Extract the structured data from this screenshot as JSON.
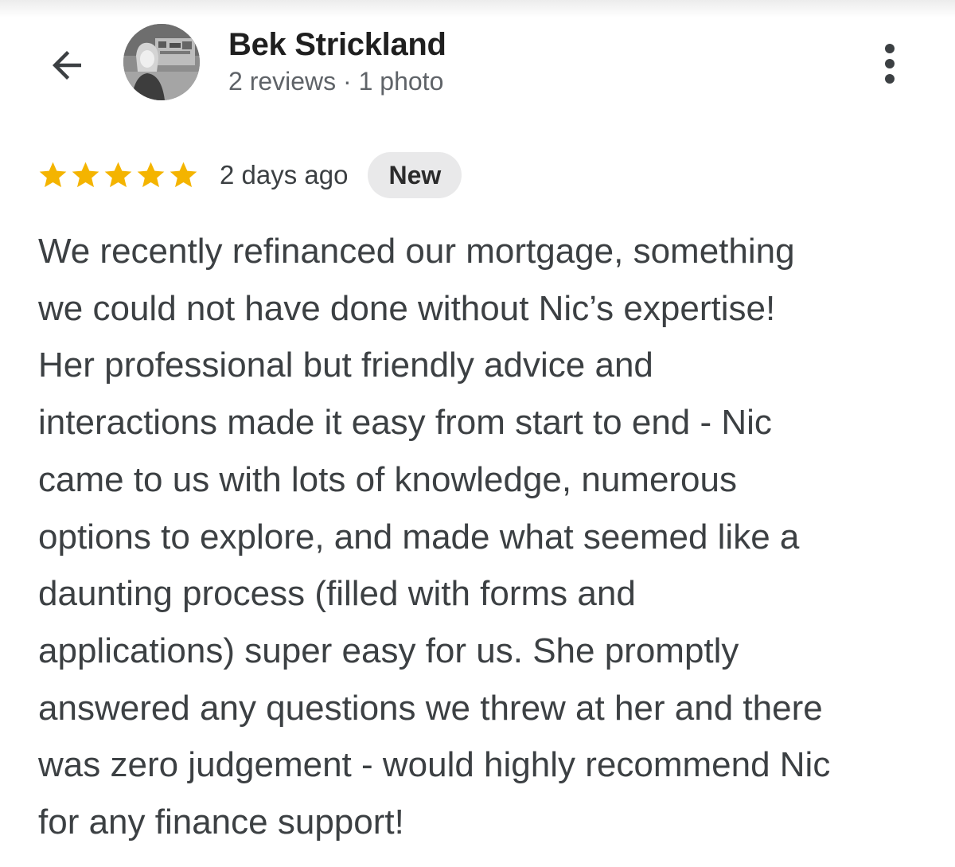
{
  "header": {
    "reviewer_name": "Bek Strickland",
    "reviewer_meta": "2 reviews · 1 photo",
    "back_icon": "arrow-left-icon",
    "more_icon": "more-vertical-icon"
  },
  "review": {
    "rating": 5,
    "rating_max": 5,
    "star_color": "#f4b400",
    "time": "2 days ago",
    "badge": "New",
    "text_lines": [
      "We recently refinanced our mortgage, something",
      "we could not have done without Nic’s expertise!",
      "Her professional but friendly advice and",
      "interactions made it easy from start to end - Nic",
      "came to us with lots of knowledge, numerous",
      "options to explore, and made what seemed like a",
      "daunting process (filled with forms and",
      "applications) super easy for us. She promptly",
      "answered any questions we threw at her and there",
      "was zero judgement - would highly recommend Nic",
      "for any finance support!"
    ]
  }
}
